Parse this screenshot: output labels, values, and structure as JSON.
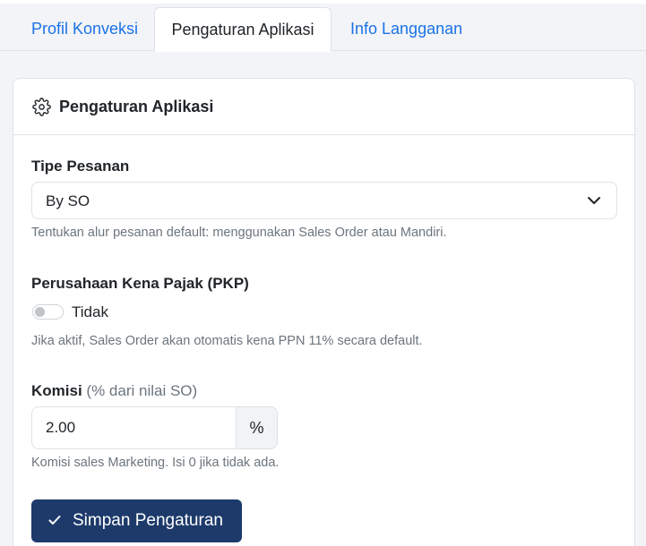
{
  "tabs": [
    {
      "label": "Profil Konveksi",
      "active": false
    },
    {
      "label": "Pengaturan Aplikasi",
      "active": true
    },
    {
      "label": "Info Langganan",
      "active": false
    }
  ],
  "card": {
    "title": "Pengaturan Aplikasi",
    "header_icon": "gear-icon"
  },
  "order_type": {
    "label": "Tipe Pesanan",
    "value": "By SO",
    "help": "Tentukan alur pesanan default: menggunakan Sales Order atau Mandiri."
  },
  "pkp": {
    "label": "Perusahaan Kena Pajak (PKP)",
    "toggle_on": false,
    "toggle_label": "Tidak",
    "help": "Jika aktif, Sales Order akan otomatis kena PPN 11% secara default."
  },
  "commission": {
    "label": "Komisi",
    "label_suffix": "(% dari nilai SO)",
    "value": "2.00",
    "unit": "%",
    "help": "Komisi sales Marketing. Isi 0 jika tidak ada."
  },
  "save_button": {
    "label": "Simpan Pengaturan",
    "icon": "check-icon"
  },
  "colors": {
    "accent": "#1a73e8",
    "button": "#1d3a6b",
    "muted": "#6c757d"
  }
}
